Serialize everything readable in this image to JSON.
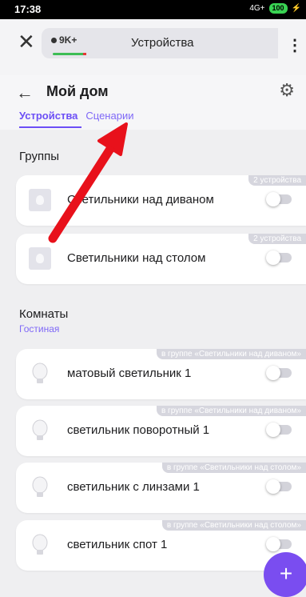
{
  "status_bar": {
    "time": "17:38",
    "signal": "4G+",
    "battery": "100"
  },
  "browser": {
    "tab_counter": "9K+",
    "tab_title": "Устройства"
  },
  "header": {
    "title": "Мой дом",
    "tabs": [
      "Устройства",
      "Сценарии"
    ]
  },
  "groups": {
    "title": "Группы",
    "items": [
      {
        "label": "Светильники над диваном",
        "badge": "2 устройства"
      },
      {
        "label": "Светильники над столом",
        "badge": "2 устройства"
      }
    ]
  },
  "rooms": {
    "title": "Комнаты",
    "room_name": "Гостиная",
    "items": [
      {
        "label": "матовый светильник 1",
        "badge": "в группе «Светильники над диваном»"
      },
      {
        "label": "светильник поворотный 1",
        "badge": "в группе «Светильники над диваном»"
      },
      {
        "label": "светильник с линзами 1",
        "badge": "в группе «Светильники над столом»"
      },
      {
        "label": "светильник спот 1",
        "badge": "в группе «Светильники над столом»"
      }
    ]
  },
  "fab": {
    "label": "+"
  },
  "colors": {
    "accent": "#6c4ff6",
    "fab": "#7a4df0",
    "annotation_arrow": "#e8111b"
  }
}
